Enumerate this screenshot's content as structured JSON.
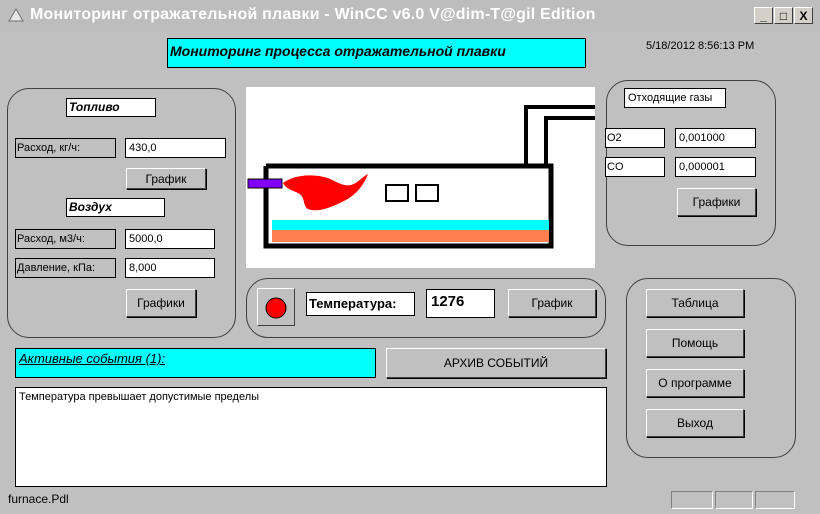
{
  "window": {
    "title": "Мониторинг отражательной плавки - WinCC v6.0 V@dim-T@gil Edition",
    "minimize_glyph": "_",
    "maximize_glyph": "□",
    "close_glyph": "X"
  },
  "header": {
    "title": "Мониторинг процесса отражательной плавки",
    "datetime": "5/18/2012 8:56:13 PM"
  },
  "fuel": {
    "title": "Топливо",
    "flow_label": "Расход, кг/ч:",
    "flow_value": "430,0",
    "chart_button": "График"
  },
  "air": {
    "title": "Воздух",
    "flow_label": "Расход, м3/ч:",
    "flow_value": "5000,0",
    "pressure_label": "Давление, кПа:",
    "pressure_value": "8,000",
    "charts_button": "Графики"
  },
  "gases": {
    "title": "Отходящие газы",
    "rows": [
      {
        "label": "O2",
        "value": "0,001000"
      },
      {
        "label": "CO",
        "value": "0,000001"
      }
    ],
    "charts_button": "Графики"
  },
  "temperature": {
    "label": "Температура:",
    "value": "1276",
    "chart_button": "График",
    "indicator_color": "#ff0000"
  },
  "events": {
    "active_label": "Активные события (1):",
    "archive_button": "АРХИВ СОБЫТИЙ",
    "messages": [
      "Температура превышает допустимые пределы"
    ]
  },
  "nav": {
    "table": "Таблица",
    "help": "Помощь",
    "about": "О программе",
    "exit": "Выход"
  },
  "status": {
    "file": "furnace.Pdl"
  },
  "colors": {
    "accent": "#00ffff",
    "background": "#c0c0c0",
    "flame": "#ff0000",
    "melt_top": "#00ffff",
    "melt_bottom": "#ff7f50",
    "burner": "#7f00ff"
  }
}
